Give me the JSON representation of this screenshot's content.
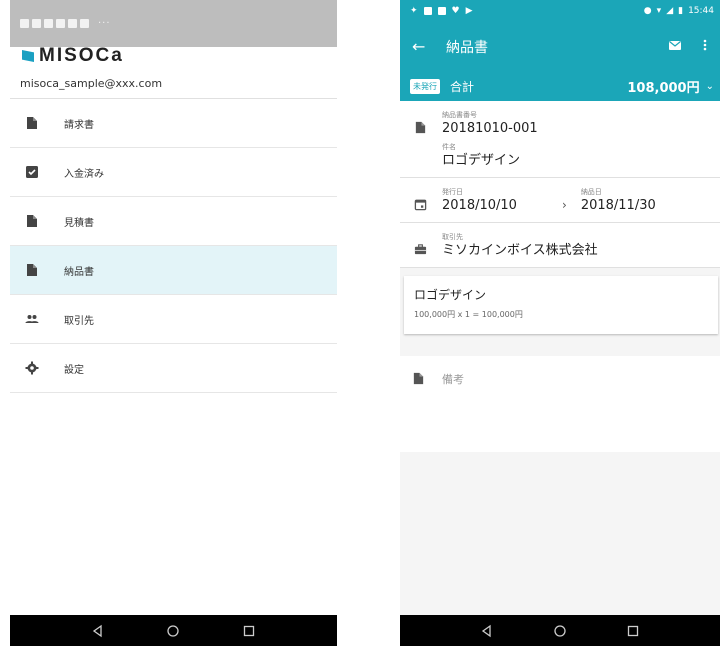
{
  "left": {
    "brand": "MISOCa",
    "email": "misoca_sample@xxx.com",
    "menu": [
      {
        "label": "請求書",
        "icon": "document-icon"
      },
      {
        "label": "入金済み",
        "icon": "checkbox-icon"
      },
      {
        "label": "見積書",
        "icon": "document-icon"
      },
      {
        "label": "納品書",
        "icon": "document-icon"
      },
      {
        "label": "取引先",
        "icon": "people-icon"
      },
      {
        "label": "設定",
        "icon": "gear-icon"
      }
    ]
  },
  "right": {
    "status_time": "15:44",
    "appbar_title": "納品書",
    "summary": {
      "badge": "未発行",
      "label": "合計",
      "value": "108,000円"
    },
    "number": {
      "caption": "納品書番号",
      "value": "20181010-001"
    },
    "subject": {
      "caption": "件名",
      "value": "ロゴデザイン"
    },
    "issue_date": {
      "caption": "発行日",
      "value": "2018/10/10"
    },
    "delivery_date": {
      "caption": "納品日",
      "value": "2018/11/30"
    },
    "client": {
      "caption": "取引先",
      "value": "ミソカインボイス株式会社"
    },
    "item": {
      "name": "ロゴデザイン",
      "detail": "100,000円 x 1 = 100,000円"
    },
    "memo_label": "備考"
  },
  "colors": {
    "accent": "#1ba6b8",
    "brand": "#1aa0c2",
    "active_row": "#e3f4f8"
  }
}
